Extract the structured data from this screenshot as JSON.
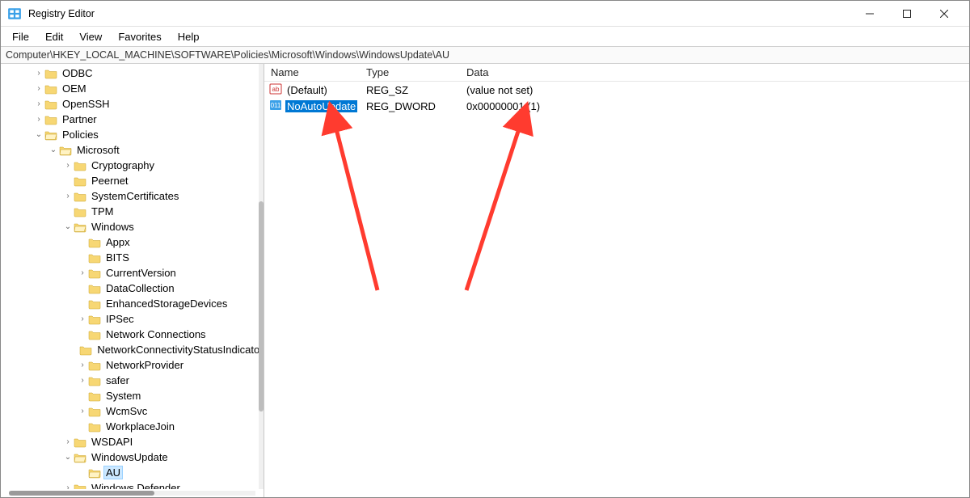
{
  "window": {
    "title": "Registry Editor"
  },
  "menu": {
    "file": "File",
    "edit": "Edit",
    "view": "View",
    "favorites": "Favorites",
    "help": "Help"
  },
  "address": "Computer\\HKEY_LOCAL_MACHINE\\SOFTWARE\\Policies\\Microsoft\\Windows\\WindowsUpdate\\AU",
  "columns": {
    "name": "Name",
    "type": "Type",
    "data": "Data"
  },
  "values": [
    {
      "icon": "string",
      "name": "(Default)",
      "type": "REG_SZ",
      "data": "(value not set)",
      "selected": false
    },
    {
      "icon": "dword",
      "name": "NoAutoUpdate",
      "type": "REG_DWORD",
      "data": "0x00000001 (1)",
      "selected": true
    }
  ],
  "tree": [
    {
      "depth": 3,
      "exp": "closed",
      "open": false,
      "label": "ODBC"
    },
    {
      "depth": 3,
      "exp": "closed",
      "open": false,
      "label": "OEM"
    },
    {
      "depth": 3,
      "exp": "closed",
      "open": false,
      "label": "OpenSSH"
    },
    {
      "depth": 3,
      "exp": "closed",
      "open": false,
      "label": "Partner"
    },
    {
      "depth": 3,
      "exp": "open",
      "open": true,
      "label": "Policies"
    },
    {
      "depth": 4,
      "exp": "open",
      "open": true,
      "label": "Microsoft"
    },
    {
      "depth": 5,
      "exp": "closed",
      "open": false,
      "label": "Cryptography"
    },
    {
      "depth": 5,
      "exp": "none",
      "open": false,
      "label": "Peernet"
    },
    {
      "depth": 5,
      "exp": "closed",
      "open": false,
      "label": "SystemCertificates"
    },
    {
      "depth": 5,
      "exp": "none",
      "open": false,
      "label": "TPM"
    },
    {
      "depth": 5,
      "exp": "open",
      "open": true,
      "label": "Windows"
    },
    {
      "depth": 6,
      "exp": "none",
      "open": false,
      "label": "Appx"
    },
    {
      "depth": 6,
      "exp": "none",
      "open": false,
      "label": "BITS"
    },
    {
      "depth": 6,
      "exp": "closed",
      "open": false,
      "label": "CurrentVersion"
    },
    {
      "depth": 6,
      "exp": "none",
      "open": false,
      "label": "DataCollection"
    },
    {
      "depth": 6,
      "exp": "none",
      "open": false,
      "label": "EnhancedStorageDevices"
    },
    {
      "depth": 6,
      "exp": "closed",
      "open": false,
      "label": "IPSec"
    },
    {
      "depth": 6,
      "exp": "none",
      "open": false,
      "label": "Network Connections"
    },
    {
      "depth": 6,
      "exp": "none",
      "open": false,
      "label": "NetworkConnectivityStatusIndicator"
    },
    {
      "depth": 6,
      "exp": "closed",
      "open": false,
      "label": "NetworkProvider"
    },
    {
      "depth": 6,
      "exp": "closed",
      "open": false,
      "label": "safer"
    },
    {
      "depth": 6,
      "exp": "none",
      "open": false,
      "label": "System"
    },
    {
      "depth": 6,
      "exp": "closed",
      "open": false,
      "label": "WcmSvc"
    },
    {
      "depth": 6,
      "exp": "none",
      "open": false,
      "label": "WorkplaceJoin"
    },
    {
      "depth": 5,
      "exp": "closed",
      "open": false,
      "label": "WSDAPI"
    },
    {
      "depth": 5,
      "exp": "open",
      "open": true,
      "label": "WindowsUpdate"
    },
    {
      "depth": 6,
      "exp": "none",
      "open": true,
      "label": "AU",
      "selected": true
    },
    {
      "depth": 5,
      "exp": "closed",
      "open": false,
      "label": "Windows Defender"
    }
  ],
  "annotation_arrows": 2
}
